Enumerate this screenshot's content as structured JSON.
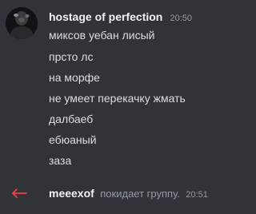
{
  "message": {
    "author": "hostage of perfection",
    "timestamp": "20:50",
    "lines": [
      "миксов  уебан лисый",
      "прсто лс",
      "на морфе",
      "не умеет перекачку жмать",
      "далбаеб",
      "ебюаный",
      "заза"
    ]
  },
  "system_message": {
    "user": "meeexof",
    "action": "покидает группу.",
    "timestamp": "20:51",
    "icon": "leave-arrow-icon",
    "icon_color": "#f23f43"
  },
  "colors": {
    "background": "#313338",
    "author": "#f2f3f5",
    "text": "#dbdee1",
    "muted": "#949ba4"
  }
}
